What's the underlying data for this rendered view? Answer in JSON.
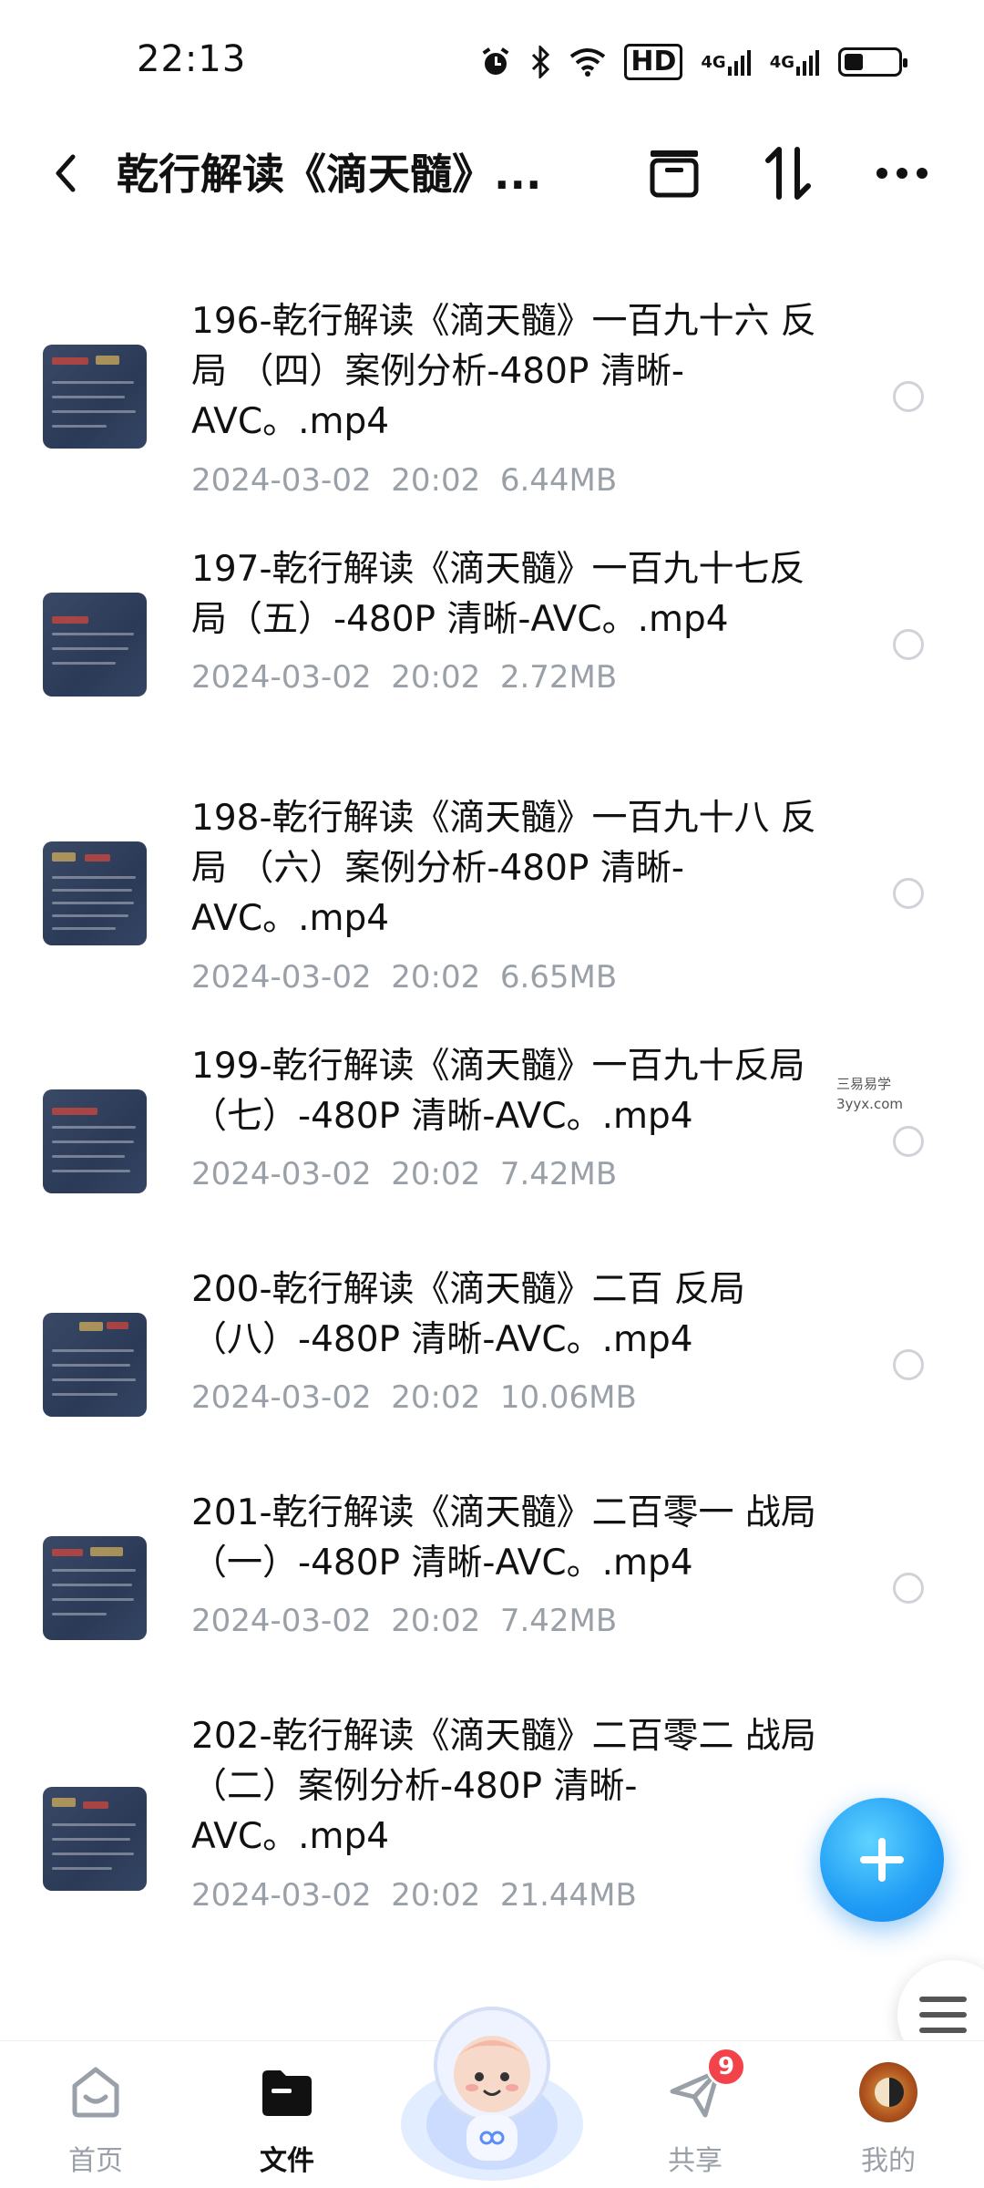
{
  "status_bar": {
    "time": "22:13",
    "icons": [
      "alarm-icon",
      "bluetooth-icon",
      "wifi-icon",
      "hd-icon",
      "signal-4g-icon",
      "signal-4g-icon",
      "battery-icon"
    ],
    "hd_label": "HD",
    "net1": "4G",
    "net2": "4G",
    "battery_level": 0.35
  },
  "header": {
    "title": "乾行解读《滴天髓》...",
    "back_icon": "chevron-left-icon",
    "actions": [
      "box-icon",
      "sort-icon",
      "more-icon"
    ]
  },
  "files": [
    {
      "name": "196-乾行解读《滴天髓》一百九十六 反局 （四）案例分析-480P 清晰-AVC。.mp4",
      "date": "2024-03-02",
      "time": "20:02",
      "size": "6.44MB"
    },
    {
      "name": "197-乾行解读《滴天髓》一百九十七反局（五）-480P 清晰-AVC。.mp4",
      "date": "2024-03-02",
      "time": "20:02",
      "size": "2.72MB"
    },
    {
      "name": "198-乾行解读《滴天髓》一百九十八 反局 （六）案例分析-480P 清晰-AVC。.mp4",
      "date": "2024-03-02",
      "time": "20:02",
      "size": "6.65MB"
    },
    {
      "name": "199-乾行解读《滴天髓》一百九十反局（七）-480P 清晰-AVC。.mp4",
      "date": "2024-03-02",
      "time": "20:02",
      "size": "7.42MB"
    },
    {
      "name": "200-乾行解读《滴天髓》二百 反局（八）-480P 清晰-AVC。.mp4",
      "date": "2024-03-02",
      "time": "20:02",
      "size": "10.06MB"
    },
    {
      "name": "201-乾行解读《滴天髓》二百零一 战局（一）-480P 清晰-AVC。.mp4",
      "date": "2024-03-02",
      "time": "20:02",
      "size": "7.42MB"
    },
    {
      "name": "202-乾行解读《滴天髓》二百零二 战局（二）案例分析-480P 清晰-AVC。.mp4",
      "date": "2024-03-02",
      "time": "20:02",
      "size": "21.44MB"
    }
  ],
  "watermark": {
    "line1": "三易易学",
    "line2": "3yyx.com"
  },
  "fab": {
    "icon": "plus-icon"
  },
  "bottom_nav": {
    "items": [
      {
        "label": "首页",
        "icon": "home-icon",
        "active": false
      },
      {
        "label": "文件",
        "icon": "folder-icon",
        "active": true
      },
      {
        "label": "共享",
        "icon": "paper-plane-icon",
        "active": false,
        "badge": "9"
      },
      {
        "label": "我的",
        "icon": "avatar-icon",
        "active": false
      }
    ]
  },
  "colors": {
    "accent": "#1f9cf5",
    "badge": "#f2434b",
    "meta_text": "#9aa0a8"
  }
}
